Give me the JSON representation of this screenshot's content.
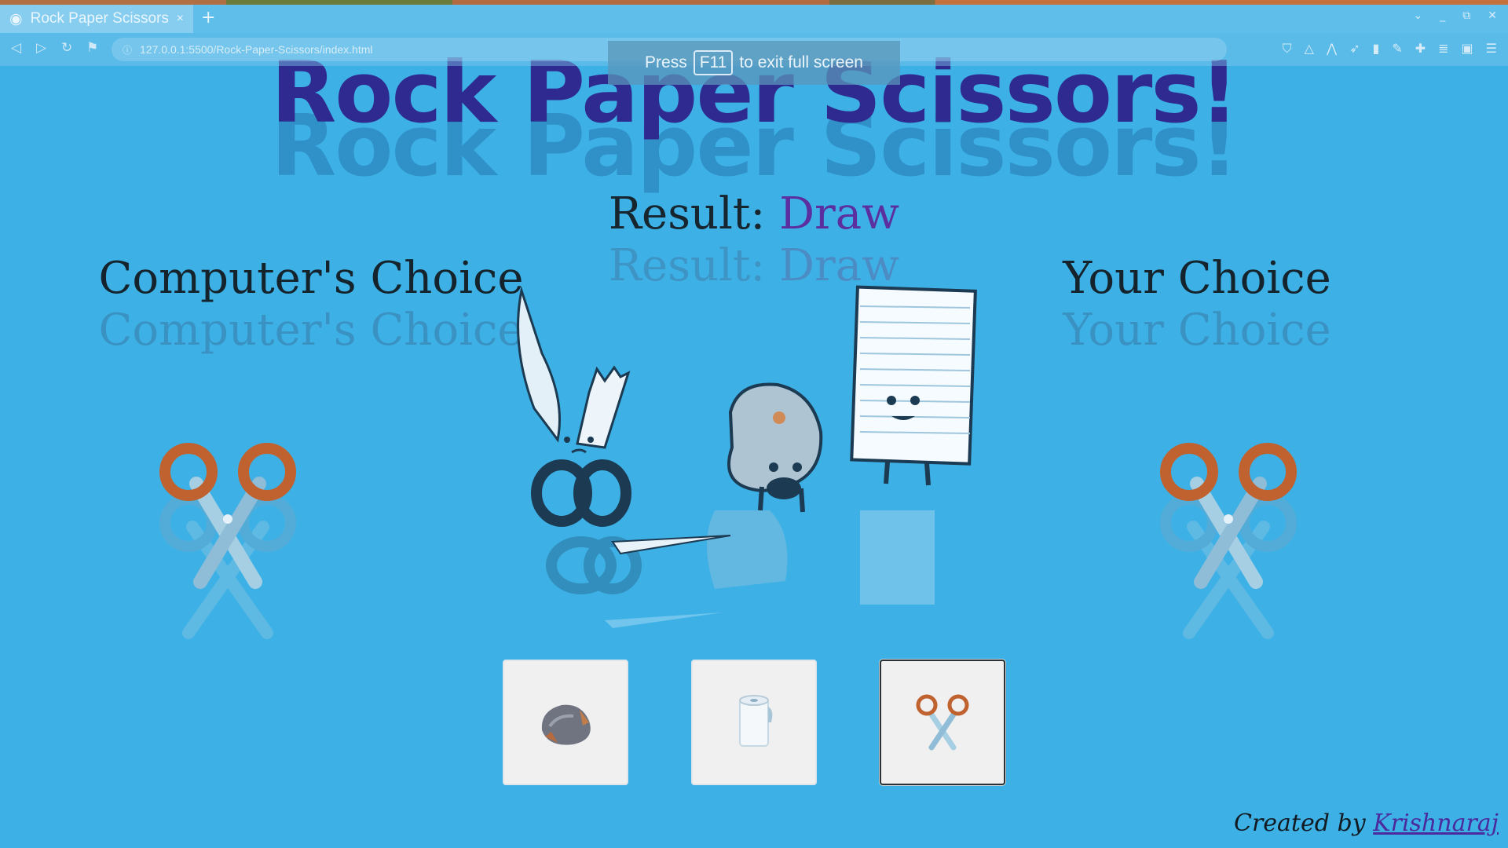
{
  "browser": {
    "tab_title": "Rock Paper Scissors",
    "tab_close": "×",
    "new_tab": "+",
    "url": "127.0.0.1:5500/Rock-Paper-Scissors/index.html",
    "fullscreen_notice": {
      "before": "Press",
      "key": "F11",
      "after": "to exit full screen"
    }
  },
  "page": {
    "title": "Rock Paper Scissors!",
    "result_label": "Result:",
    "result_value": "Draw",
    "computer_heading": "Computer's Choice",
    "user_heading": "Your Choice",
    "computer_choice": "scissors",
    "user_choice": "scissors",
    "buttons": [
      {
        "id": "rock",
        "icon": "rock-icon"
      },
      {
        "id": "paper",
        "icon": "paper-icon"
      },
      {
        "id": "scissors",
        "icon": "scissors-icon",
        "selected": true
      }
    ],
    "footer_prefix": "Created by",
    "footer_author": "Krishnaraj"
  },
  "colors": {
    "background": "#3db1e6",
    "title": "#2f2a8f",
    "result_value": "#5b2fa0",
    "scissor_handle": "#c0622f",
    "scissor_blade": "#8fbcd6"
  }
}
